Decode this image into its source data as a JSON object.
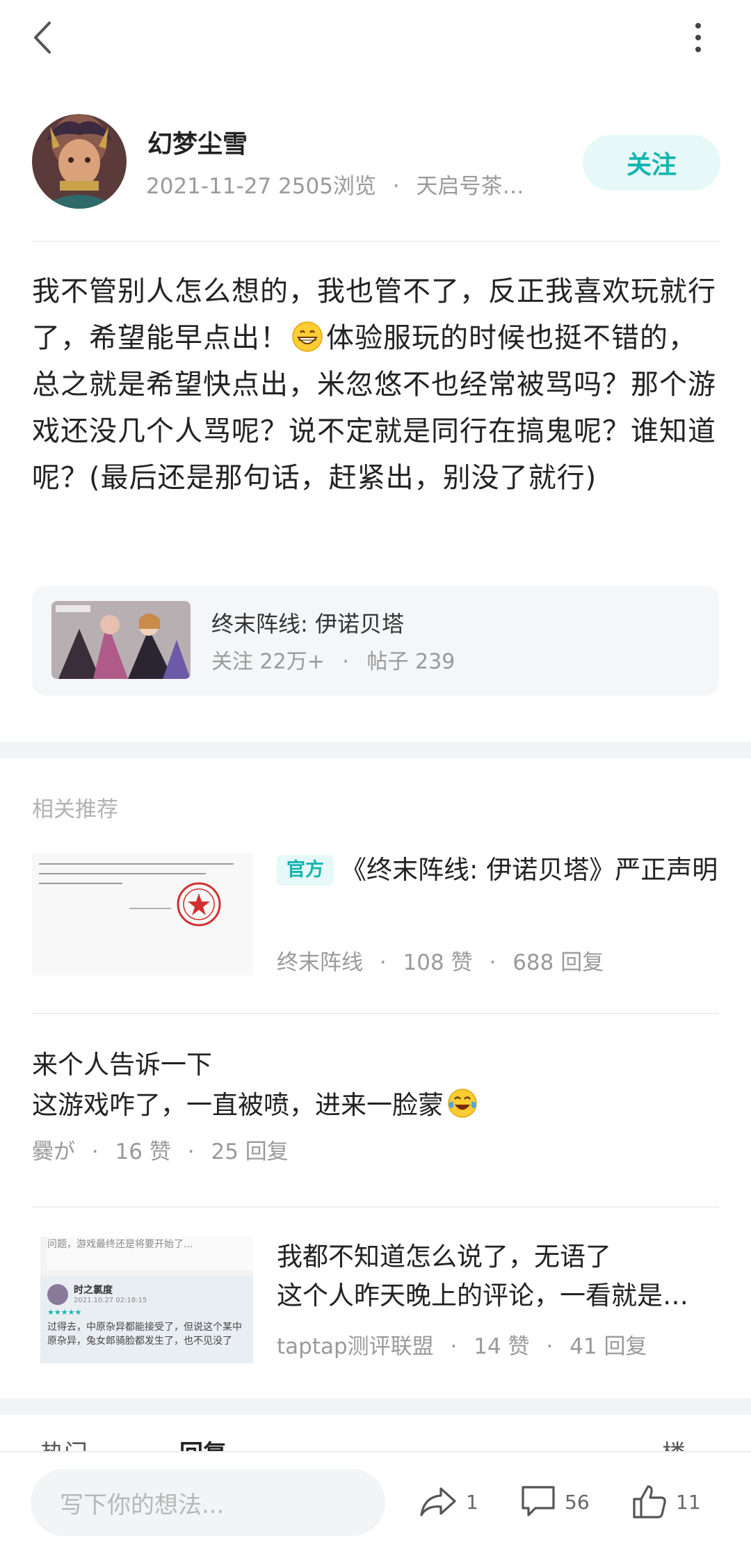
{
  "author": {
    "name": "幻梦尘雪",
    "date": "2021-11-27",
    "views": "2505浏览",
    "separator": "·",
    "channel": "天启号茶…",
    "follow_label": "关注"
  },
  "post": {
    "text_before_emoji": "我不管别人怎么想的，我也管不了，反正我喜欢玩就行了，希望能早点出！",
    "emoji_icon": "grinning-face-icon",
    "text_after_emoji": "体验服玩的时候也挺不错的，总之就是希望快点出，米忽悠不也经常被骂吗？那个游戏还没几个人骂呢？说不定就是同行在搞鬼呢？谁知道呢？(最后还是那句话，赶紧出，别没了就行)"
  },
  "game_card": {
    "name": "终末阵线: 伊诺贝塔",
    "follows": "关注 22万+",
    "separator": "·",
    "posts": "帖子 239"
  },
  "related": {
    "title": "相关推荐",
    "items": [
      {
        "tag": "官方",
        "title": "《终末阵线: 伊诺贝塔》严正声明",
        "author": "终末阵线",
        "likes": "108 赞",
        "replies": "688 回复"
      },
      {
        "line1": "来个人告诉一下",
        "line2": "这游戏咋了，一直被喷，进来一脸蒙",
        "emoji_icon": "tears-of-joy-icon",
        "author": "爨が",
        "likes": "16 赞",
        "replies": "25 回复"
      },
      {
        "line1": "我都不知道怎么说了，无语了",
        "line2": "这个人昨天晚上的评论，一看就是…",
        "author": "taptap测评联盟",
        "likes": "14 赞",
        "replies": "41 回复",
        "thumb_text": {
          "top": "问题，游戏最终还是将要开始了...",
          "reviewer": "时之氯度",
          "time": "2021.10.27 02:18:15",
          "stars": "★★★★★",
          "body": "过得去，中原杂异都能接受了，但说这个某中原杂异，兔女郎骑脸都发生了，也不见没了"
        }
      }
    ]
  },
  "tabs": {
    "left1": "热门",
    "left2": "回复",
    "right": "楼"
  },
  "bottom_bar": {
    "input_placeholder": "写下你的想法...",
    "share_count": "1",
    "comment_count": "56",
    "like_count": "11"
  }
}
